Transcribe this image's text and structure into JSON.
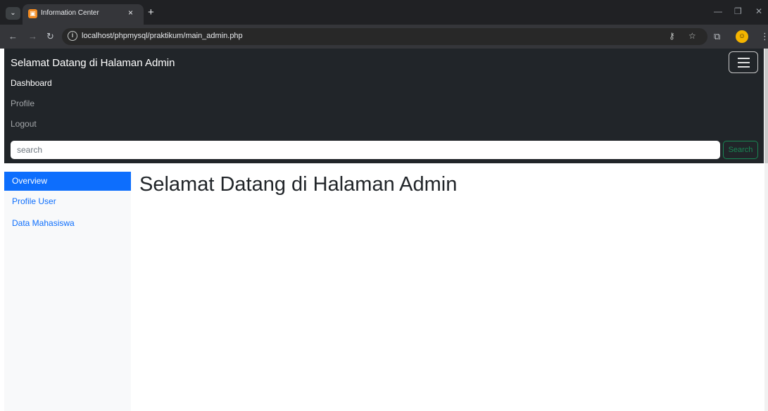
{
  "browser": {
    "tab_title": "Information Center",
    "tab_close": "×",
    "new_tab": "+",
    "url": "localhost/phpmysql/praktikum/main_admin.php"
  },
  "navbar": {
    "brand": "Selamat Datang di Halaman Admin",
    "links": [
      "Dashboard",
      "Profile",
      "Logout"
    ],
    "search_placeholder": "search",
    "search_button": "Search"
  },
  "sidebar": {
    "items": [
      "Overview",
      "Profile User",
      "Data Mahasiswa"
    ]
  },
  "main": {
    "title": "Selamat Datang di Halaman Admin"
  },
  "colors": {
    "navbar_bg": "#212529",
    "primary": "#0d6efd",
    "success": "#198754"
  }
}
